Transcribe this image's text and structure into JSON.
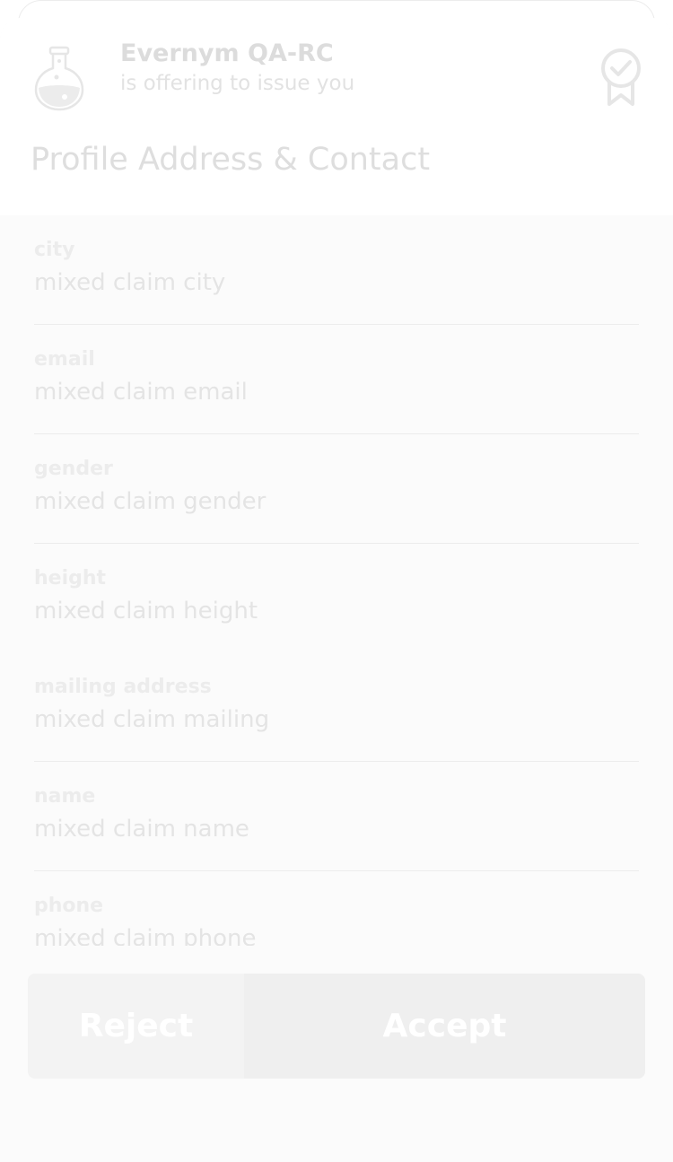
{
  "issuer": {
    "name": "Evernym QA-RC",
    "subtitle": "is offering to issue you",
    "logo_icon": "flask-icon",
    "badge_icon": "award-ribbon-icon"
  },
  "credential": {
    "title": "Profile Address & Contact"
  },
  "attributes": [
    {
      "label": "city",
      "value": "mixed claim city"
    },
    {
      "label": "email",
      "value": "mixed claim email"
    },
    {
      "label": "gender",
      "value": "mixed claim gender"
    },
    {
      "label": "height",
      "value": "mixed claim height"
    },
    {
      "label": "mailing address",
      "value": "mixed claim mailing"
    },
    {
      "label": "name",
      "value": "mixed claim name"
    },
    {
      "label": "phone",
      "value": "mixed claim phone"
    }
  ],
  "actions": {
    "reject_label": "Reject",
    "accept_label": "Accept"
  },
  "colors": {
    "card_background": "#fbfbfb",
    "header_background": "#ffffff",
    "reject_button": "#f3f3f3",
    "accept_button": "#efefef"
  }
}
